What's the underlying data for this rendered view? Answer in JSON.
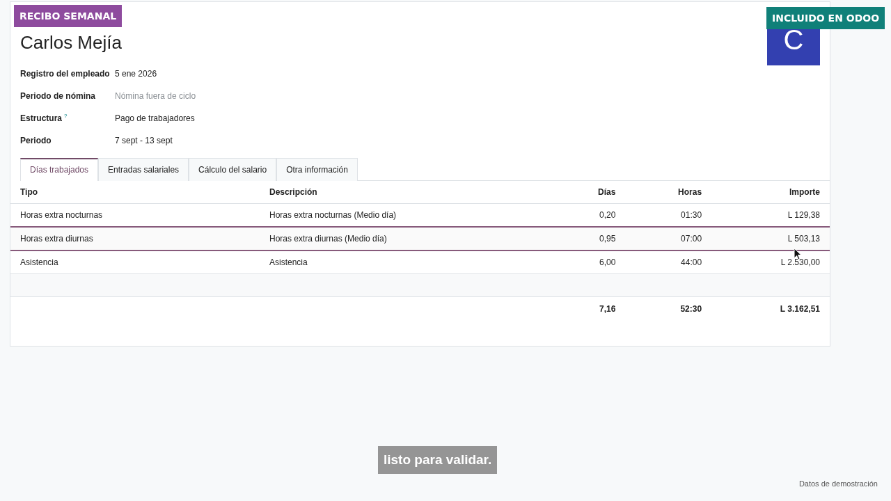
{
  "badges": {
    "left": "RECIBO SEMANAL",
    "right": "INCLUIDO EN ODOO"
  },
  "employee": {
    "name": "Carlos Mejía",
    "avatar_letter": "C"
  },
  "fields": [
    {
      "label": "Registro del empleado",
      "value": "5 ene 2026"
    },
    {
      "label": "Periodo de nómina",
      "placeholder": "Nómina fuera de ciclo"
    },
    {
      "label": "Estructura",
      "help": "?",
      "value": "Pago de trabajadores"
    },
    {
      "label": "Periodo",
      "value": "7 sept - 13 sept"
    }
  ],
  "tabs": [
    {
      "label": "Días trabajados",
      "selected": true
    },
    {
      "label": "Entradas salariales",
      "selected": false
    },
    {
      "label": "Cálculo del salario",
      "selected": false
    },
    {
      "label": "Otra información",
      "selected": false
    }
  ],
  "table": {
    "columns": [
      "Tipo",
      "Descripción",
      "Días",
      "Horas",
      "Importe"
    ],
    "rows": [
      {
        "tipo": "Horas extra nocturnas",
        "descripcion": "Horas extra nocturnas (Medio día)",
        "dias": "0,20",
        "horas": "01:30",
        "importe": "L 129,38",
        "selected": false
      },
      {
        "tipo": "Horas extra diurnas",
        "descripcion": "Horas extra diurnas (Medio día)",
        "dias": "0,95",
        "horas": "07:00",
        "importe": "L 503,13",
        "selected": true
      },
      {
        "tipo": "Asistencia",
        "descripcion": "Asistencia",
        "dias": "6,00",
        "horas": "44:00",
        "importe": "L 2.530,00",
        "selected": false
      }
    ],
    "totals": {
      "dias": "7,16",
      "horas": "52:30",
      "importe": "L 3.162,51"
    }
  },
  "caption": "listo para validar.",
  "footer_note": "Datos de demostración"
}
